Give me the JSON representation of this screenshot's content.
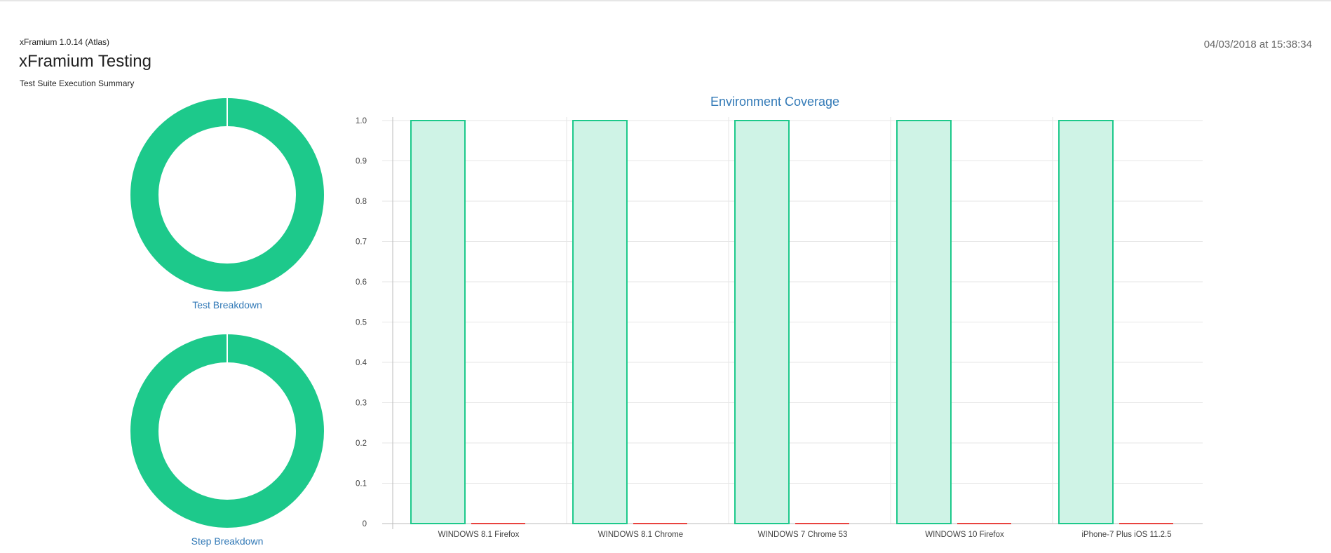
{
  "header": {
    "version": "xFramium 1.0.14 (Atlas)",
    "title": "xFramium Testing",
    "subtitle": "Test Suite Execution Summary",
    "timestamp": "04/03/2018 at 15:38:34"
  },
  "colors": {
    "pass": "#1dc98b",
    "pass_fill": "#cff3e6",
    "fail": "#e8433f",
    "link": "#337ab7",
    "grid": "#e6e6e6",
    "axis": "#bbbbbb"
  },
  "donuts": [
    {
      "label": "Test Breakdown",
      "segments": [
        {
          "status": "pass",
          "fraction": 1.0
        }
      ]
    },
    {
      "label": "Step Breakdown",
      "segments": [
        {
          "status": "pass",
          "fraction": 1.0
        }
      ]
    }
  ],
  "chart_data": {
    "type": "bar",
    "title": "Environment Coverage",
    "categories": [
      "WINDOWS 8.1 Firefox",
      "WINDOWS 8.1 Chrome",
      "WINDOWS 7 Chrome 53",
      "WINDOWS 10 Firefox",
      "iPhone-7 Plus iOS 11.2.5"
    ],
    "series": [
      {
        "status": "pass",
        "values": [
          1.0,
          1.0,
          1.0,
          1.0,
          1.0
        ]
      },
      {
        "status": "fail",
        "values": [
          0,
          0,
          0,
          0,
          0
        ]
      }
    ],
    "ylim": [
      0,
      1.0
    ],
    "yticks": [
      "0",
      "0.1",
      "0.2",
      "0.3",
      "0.4",
      "0.5",
      "0.6",
      "0.7",
      "0.8",
      "0.9",
      "1.0"
    ],
    "grid": true,
    "xlabel": "",
    "ylabel": ""
  }
}
